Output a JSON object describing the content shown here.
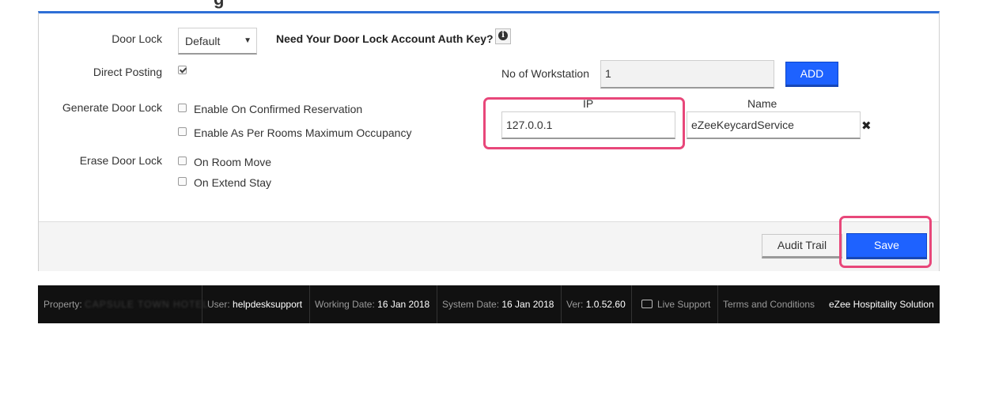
{
  "header": {
    "partial_title_glyph": "g"
  },
  "form": {
    "door_lock": {
      "label": "Door Lock",
      "selected": "Default"
    },
    "auth_key": {
      "text": "Need Your Door Lock Account Auth Key?"
    },
    "direct_posting": {
      "label": "Direct Posting",
      "checked": true
    },
    "generate_door_lock": {
      "label": "Generate Door Lock",
      "options": [
        {
          "label": "Enable On Confirmed Reservation",
          "checked": false
        },
        {
          "label": "Enable As Per Rooms Maximum Occupancy",
          "checked": false
        }
      ]
    },
    "erase_door_lock": {
      "label": "Erase Door Lock",
      "options": [
        {
          "label": "On Room Move",
          "checked": false
        },
        {
          "label": "On Extend Stay",
          "checked": false
        }
      ]
    },
    "workstation": {
      "label": "No of Workstation",
      "value": "1",
      "add_label": "ADD"
    },
    "ip": {
      "header": "IP",
      "value": "127.0.0.1"
    },
    "name": {
      "header": "Name",
      "value": "eZeeKeycardService"
    }
  },
  "footer": {
    "audit_label": "Audit Trail",
    "save_label": "Save"
  },
  "statusbar": {
    "property_label": "Property:",
    "property_value": "CAPSULE TOWN HOTEL",
    "user_label": "User:",
    "user_value": "helpdesksupport",
    "working_date_label": "Working Date:",
    "working_date_value": "16 Jan 2018",
    "system_date_label": "System Date:",
    "system_date_value": "16 Jan 2018",
    "ver_label": "Ver:",
    "ver_value": "1.0.52.60",
    "live_support": "Live Support",
    "terms": "Terms and Conditions",
    "brand": "eZee Hospitality Solution"
  },
  "colors": {
    "accent": "#2f6fd6",
    "primary_button": "#1e62ff",
    "highlight": "#e8477a",
    "statusbar_bg": "#111111"
  },
  "icons": [
    "info-icon",
    "checkbox-icon",
    "dropdown-arrow-icon",
    "close-icon",
    "chat-icon"
  ]
}
